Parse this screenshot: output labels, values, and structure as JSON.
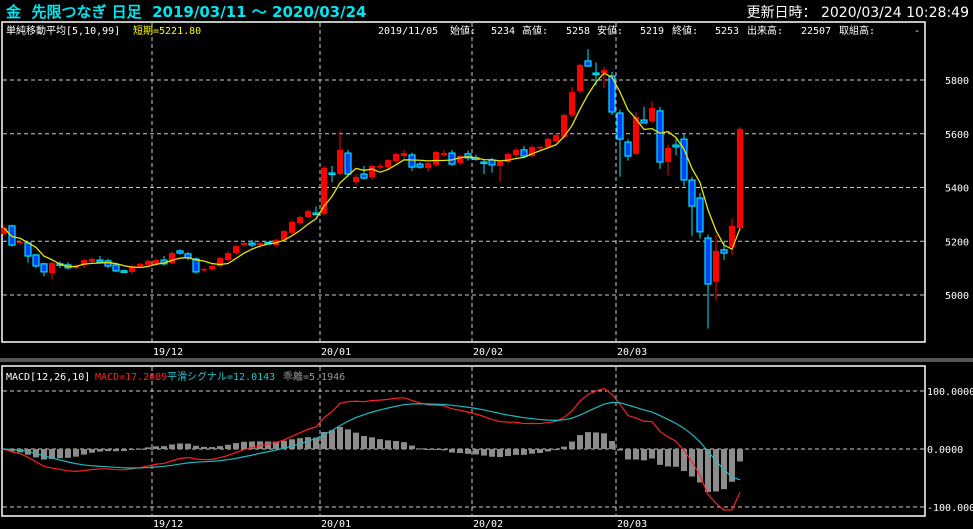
{
  "header": {
    "title": "金  先限つなぎ 日足  2019/03/11 ～ 2020/03/24",
    "updated": "更新日時： 2020/03/24 10:28:49"
  },
  "main_legend": {
    "label": "単純移動平均[5,10,99]",
    "short": "短期=5221.80"
  },
  "info": {
    "date": "2019/11/05",
    "open_label": "始値:",
    "open": "5234",
    "high_label": "高値:",
    "high": "5258",
    "low_label": "安値:",
    "low": "5219",
    "close_label": "終値:",
    "close": "5253",
    "volume_label": "出来高:",
    "volume": "22507",
    "oi_label": "取組高:",
    "oi": "-"
  },
  "macd_legend": {
    "label": "MACD[12,26,10]",
    "macd": "MACD=17.2089",
    "signal": "平滑シグナル=12.0143",
    "diff": "乖離=5.1946"
  },
  "colors": {
    "up": "#ff0000",
    "down_fill": "#0040ff",
    "down_edge": "#00e5ff",
    "ma": "#e6e600",
    "macd": "#ff2020",
    "signal": "#20b8c0",
    "hist": "#8c8c8c",
    "title": "#00e5f0"
  },
  "chart_data": [
    {
      "type": "candlestick",
      "price_ylim": [
        4800,
        6000
      ],
      "yticks": [
        5000,
        5200,
        5400,
        5600,
        5800
      ],
      "xticks": [
        {
          "label": "19/12",
          "index": 19
        },
        {
          "label": "20/01",
          "index": 40
        },
        {
          "label": "20/02",
          "index": 59
        },
        {
          "label": "20/03",
          "index": 77
        }
      ],
      "ma_period": 5,
      "ohlc": [
        [
          5227,
          5262,
          5220,
          5249
        ],
        [
          5257,
          5262,
          5180,
          5186
        ],
        [
          5193,
          5200,
          5188,
          5198
        ],
        [
          5194,
          5198,
          5120,
          5145
        ],
        [
          5149,
          5152,
          5100,
          5108
        ],
        [
          5116,
          5118,
          5070,
          5086
        ],
        [
          5082,
          5125,
          5060,
          5119
        ],
        [
          5116,
          5125,
          5100,
          5116
        ],
        [
          5112,
          5122,
          5095,
          5101
        ],
        [
          5101,
          5115,
          5095,
          5108
        ],
        [
          5112,
          5135,
          5100,
          5130
        ],
        [
          5123,
          5140,
          5115,
          5134
        ],
        [
          5130,
          5145,
          5118,
          5123
        ],
        [
          5127,
          5135,
          5100,
          5108
        ],
        [
          5112,
          5118,
          5085,
          5090
        ],
        [
          5090,
          5095,
          5082,
          5090
        ],
        [
          5086,
          5112,
          5078,
          5108
        ],
        [
          5105,
          5120,
          5100,
          5116
        ],
        [
          5112,
          5132,
          5105,
          5127
        ],
        [
          5116,
          5136,
          5110,
          5130
        ],
        [
          5130,
          5145,
          5110,
          5116
        ],
        [
          5119,
          5162,
          5115,
          5156
        ],
        [
          5164,
          5170,
          5150,
          5156
        ],
        [
          5153,
          5160,
          5130,
          5138
        ],
        [
          5134,
          5140,
          5080,
          5086
        ],
        [
          5093,
          5100,
          5085,
          5097
        ],
        [
          5097,
          5112,
          5090,
          5108
        ],
        [
          5108,
          5142,
          5102,
          5138
        ],
        [
          5130,
          5162,
          5125,
          5156
        ],
        [
          5156,
          5188,
          5150,
          5182
        ],
        [
          5186,
          5198,
          5180,
          5193
        ],
        [
          5193,
          5205,
          5178,
          5186
        ],
        [
          5186,
          5198,
          5175,
          5193
        ],
        [
          5195,
          5200,
          5190,
          5195
        ],
        [
          5186,
          5210,
          5180,
          5205
        ],
        [
          5205,
          5242,
          5200,
          5238
        ],
        [
          5231,
          5278,
          5228,
          5272
        ],
        [
          5268,
          5296,
          5262,
          5290
        ],
        [
          5290,
          5318,
          5285,
          5313
        ],
        [
          5305,
          5330,
          5298,
          5305
        ],
        [
          5302,
          5480,
          5295,
          5473
        ],
        [
          5454,
          5480,
          5420,
          5454
        ],
        [
          5450,
          5612,
          5445,
          5540
        ],
        [
          5528,
          5540,
          5440,
          5450
        ],
        [
          5420,
          5450,
          5410,
          5439
        ],
        [
          5450,
          5480,
          5430,
          5435
        ],
        [
          5439,
          5484,
          5430,
          5480
        ],
        [
          5476,
          5490,
          5465,
          5480
        ],
        [
          5476,
          5506,
          5470,
          5502
        ],
        [
          5499,
          5530,
          5490,
          5525
        ],
        [
          5517,
          5540,
          5510,
          5528
        ],
        [
          5521,
          5530,
          5462,
          5476
        ],
        [
          5487,
          5495,
          5470,
          5476
        ],
        [
          5472,
          5495,
          5458,
          5491
        ],
        [
          5484,
          5535,
          5478,
          5532
        ],
        [
          5521,
          5540,
          5515,
          5528
        ],
        [
          5528,
          5540,
          5480,
          5487
        ],
        [
          5491,
          5522,
          5485,
          5517
        ],
        [
          5525,
          5538,
          5500,
          5510
        ],
        [
          5510,
          5522,
          5500,
          5510
        ],
        [
          5495,
          5505,
          5450,
          5495
        ],
        [
          5502,
          5510,
          5455,
          5484
        ],
        [
          5480,
          5500,
          5420,
          5495
        ],
        [
          5495,
          5530,
          5490,
          5525
        ],
        [
          5521,
          5548,
          5515,
          5540
        ],
        [
          5540,
          5555,
          5510,
          5517
        ],
        [
          5517,
          5556,
          5512,
          5551
        ],
        [
          5547,
          5556,
          5540,
          5551
        ],
        [
          5551,
          5585,
          5546,
          5581
        ],
        [
          5573,
          5600,
          5568,
          5595
        ],
        [
          5588,
          5675,
          5582,
          5670
        ],
        [
          5670,
          5775,
          5660,
          5755
        ],
        [
          5759,
          5860,
          5750,
          5856
        ],
        [
          5871,
          5915,
          5850,
          5852
        ],
        [
          5826,
          5865,
          5780,
          5826
        ],
        [
          5826,
          5850,
          5770,
          5837
        ],
        [
          5815,
          5830,
          5670,
          5681
        ],
        [
          5677,
          5690,
          5440,
          5580
        ],
        [
          5569,
          5580,
          5500,
          5517
        ],
        [
          5525,
          5680,
          5520,
          5662
        ],
        [
          5651,
          5700,
          5640,
          5640
        ],
        [
          5647,
          5720,
          5640,
          5696
        ],
        [
          5685,
          5700,
          5470,
          5495
        ],
        [
          5495,
          5560,
          5445,
          5547
        ],
        [
          5558,
          5580,
          5520,
          5551
        ],
        [
          5580,
          5600,
          5405,
          5428
        ],
        [
          5428,
          5440,
          5220,
          5331
        ],
        [
          5361,
          5380,
          5210,
          5235
        ],
        [
          5212,
          5225,
          4875,
          5041
        ],
        [
          5049,
          5225,
          4980,
          5164
        ],
        [
          5168,
          5200,
          5130,
          5156
        ],
        [
          5179,
          5285,
          5150,
          5257
        ],
        [
          5249,
          5625,
          5245,
          5618
        ]
      ]
    },
    {
      "type": "line+bar",
      "name": "MACD[12,26,10]",
      "ylim": [
        -120,
        130
      ],
      "yticks": [
        {
          "v": 100,
          "label": "100.0000"
        },
        {
          "v": 0,
          "label": "0.0000"
        },
        {
          "v": -100,
          "label": "-100.000"
        }
      ],
      "fast": 12,
      "slow": 26,
      "signal": 10
    }
  ]
}
